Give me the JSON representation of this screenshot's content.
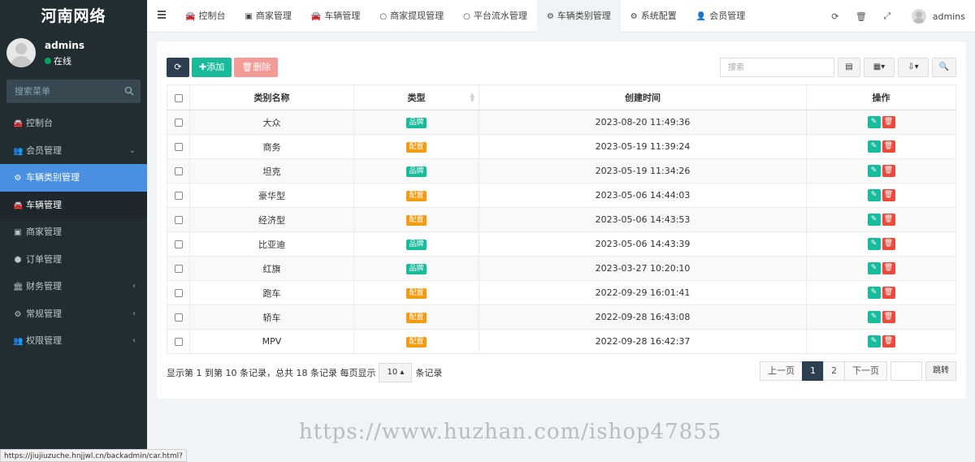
{
  "sidebar": {
    "logo": "河南网络",
    "user": {
      "name": "admins",
      "status": "在线"
    },
    "search_placeholder": "搜索菜单",
    "items": [
      {
        "label": "控制台",
        "icon": "car-icon"
      },
      {
        "label": "会员管理",
        "icon": "users-icon",
        "arrow": "⌄"
      },
      {
        "label": "车辆类别管理",
        "icon": "gear-icon"
      },
      {
        "label": "车辆管理",
        "icon": "car-icon"
      },
      {
        "label": "商家管理",
        "icon": "store-icon"
      },
      {
        "label": "订单管理",
        "icon": "cube-icon"
      },
      {
        "label": "财务管理",
        "icon": "bank-icon",
        "arrow": "‹"
      },
      {
        "label": "常规管理",
        "icon": "cogs-icon",
        "arrow": "‹"
      },
      {
        "label": "权限管理",
        "icon": "users-icon",
        "arrow": "‹"
      }
    ],
    "status_url": "https://jiujiuzuche.hnjjwl.cn/backadmin/car.html?ref=addtabs"
  },
  "topbar": {
    "tabs": [
      {
        "label": "控制台",
        "icon": "car-icon"
      },
      {
        "label": "商家管理",
        "icon": "store-icon"
      },
      {
        "label": "车辆管理",
        "icon": "car-icon"
      },
      {
        "label": "商家提现管理",
        "icon": "circle-icon"
      },
      {
        "label": "平台流水管理",
        "icon": "circle-icon"
      },
      {
        "label": "车辆类别管理",
        "icon": "gear-icon"
      },
      {
        "label": "系统配置",
        "icon": "gear-icon"
      },
      {
        "label": "会员管理",
        "icon": "user-icon"
      }
    ],
    "user": "admins"
  },
  "toolbar": {
    "add_label": "添加",
    "delete_label": "删除",
    "search_placeholder": "搜索"
  },
  "table": {
    "columns": [
      "类别名称",
      "类型",
      "创建时间",
      "操作"
    ],
    "rows": [
      {
        "name": "大众",
        "type": "品牌",
        "created": "2023-08-20 11:49:36"
      },
      {
        "name": "商务",
        "type": "配置",
        "created": "2023-05-19 11:39:24"
      },
      {
        "name": "坦克",
        "type": "品牌",
        "created": "2023-05-19 11:34:26"
      },
      {
        "name": "豪华型",
        "type": "配置",
        "created": "2023-05-06 14:44:03"
      },
      {
        "name": "经济型",
        "type": "配置",
        "created": "2023-05-06 14:43:53"
      },
      {
        "name": "比亚迪",
        "type": "品牌",
        "created": "2023-05-06 14:43:39"
      },
      {
        "name": "红旗",
        "type": "品牌",
        "created": "2023-03-27 10:20:10"
      },
      {
        "name": "跑车",
        "type": "配置",
        "created": "2022-09-29 16:01:41"
      },
      {
        "name": "轿车",
        "type": "配置",
        "created": "2022-09-28 16:43:08"
      },
      {
        "name": "MPV",
        "type": "配置",
        "created": "2022-09-28 16:42:37"
      }
    ]
  },
  "footer": {
    "info_before": "显示第 1 到第 10 条记录，总共 18 条记录 每页显示",
    "page_size": "10",
    "info_after": "条记录",
    "prev": "上一页",
    "pages": [
      "1",
      "2"
    ],
    "next": "下一页",
    "jump": "跳转"
  },
  "watermark": "https://www.huzhan.com/ishop47855",
  "colors": {
    "brand": "#18bc9c",
    "config": "#f39c12",
    "sidebar_active": "#4a90e2",
    "danger": "#e74c3c"
  }
}
